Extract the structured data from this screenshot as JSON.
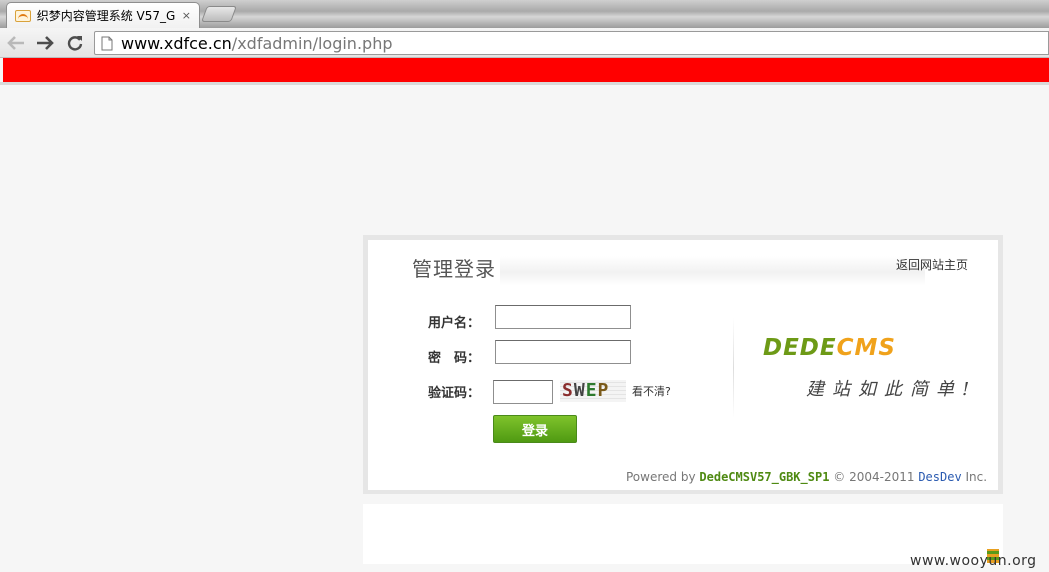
{
  "browser": {
    "tab_title": "织梦内容管理系统 V57_G",
    "tab_close": "×",
    "url_host": "www.xdfce.cn",
    "url_path": "/xdfadmin/login.php"
  },
  "login": {
    "title": "管理登录",
    "home_link": "返回网站主页",
    "username_label": "用户名：",
    "password_label": "密　码：",
    "captcha_label": "验证码：",
    "captcha_chars": [
      "S",
      "W",
      "E",
      "P"
    ],
    "captcha_refresh": "看不清?",
    "submit_label": "登录"
  },
  "brand": {
    "logo_part1": "DEDE",
    "logo_part2": "CMS",
    "slogan": "建站如此简单!"
  },
  "footer": {
    "powered_prefix": "Powered by",
    "version": "DedeCMSV57_GBK_SP1",
    "copyright": "© 2004-2011",
    "company": "DesDev",
    "suffix": "Inc."
  },
  "watermark": "www.wooyun.org",
  "colors": {
    "redaction": "#ff0000",
    "button_green": "#5aa51a",
    "logo_green": "#6d9a16",
    "logo_orange": "#f0a21b"
  }
}
